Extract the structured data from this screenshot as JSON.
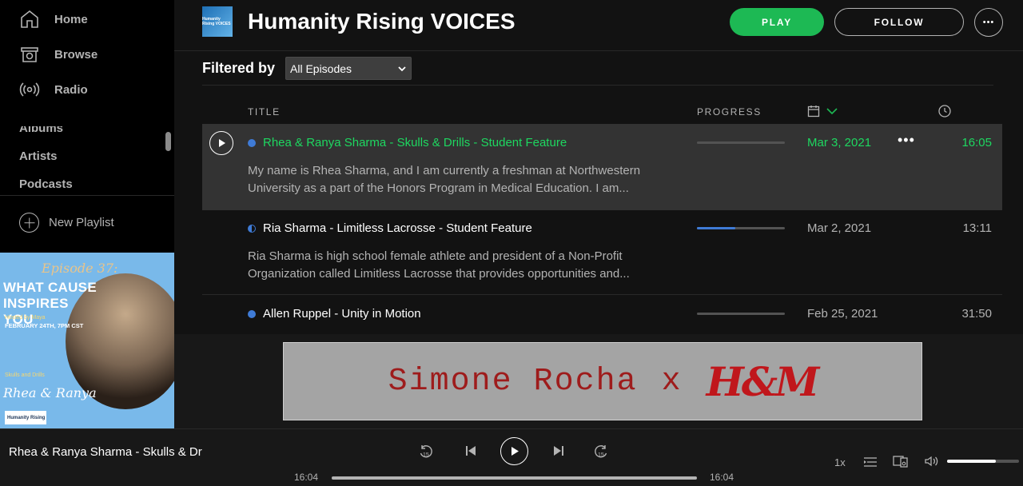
{
  "sidebar": {
    "nav": [
      {
        "label": "Home",
        "icon": "home-icon"
      },
      {
        "label": "Browse",
        "icon": "browse-icon"
      },
      {
        "label": "Radio",
        "icon": "radio-icon"
      }
    ],
    "library": [
      "Albums",
      "Artists",
      "Podcasts"
    ],
    "new_playlist": "New Playlist",
    "cover": {
      "episode": "Episode 37:",
      "headline": "WHAT CAUSE INSPIRES YOU",
      "hosted": "Hosted by Maya",
      "date": "FEBRUARY 24TH, 7PM CST",
      "topic": "Skulls and Drills",
      "names": "Rhea & Ranya",
      "logo": "Humanity Rising"
    }
  },
  "header": {
    "thumb_text": "Humanity Rising VOICES",
    "title": "Humanity Rising VOICES",
    "play_label": "PLAY",
    "follow_label": "FOLLOW",
    "more_label": "•••",
    "accent_color": "#1db954"
  },
  "filter": {
    "label": "Filtered by",
    "selected": "All Episodes"
  },
  "columns": {
    "title": "TITLE",
    "progress": "PROGRESS",
    "date_icon": "calendar-icon",
    "duration_icon": "clock-icon"
  },
  "episodes": [
    {
      "title": "Rhea & Ranya Sharma - Skulls & Drills - Student Feature",
      "desc1": "My name is Rhea Sharma, and I am currently a freshman at Northwestern",
      "desc2": "University as a part of the Honors Program in Medical Education. I am...",
      "progress": 0.0,
      "date": "Mar 3, 2021",
      "duration": "16:05",
      "more": "•••"
    },
    {
      "title": "Ria Sharma - Limitless Lacrosse - Student Feature",
      "desc1": "Ria Sharma is high school female athlete and president of a Non-Profit",
      "desc2": "Organization called Limitless Lacrosse that provides opportunities and...",
      "progress": 0.44,
      "date": "Mar 2, 2021",
      "duration": "13:11"
    },
    {
      "title": "Allen Ruppel - Unity in Motion",
      "progress": 0.0,
      "date": "Feb 25, 2021",
      "duration": "31:50"
    }
  ],
  "ad": {
    "brand": "Simone Rocha",
    "x": "x",
    "partner": "H&M"
  },
  "player": {
    "now_playing": "Rhea & Ranya Sharma - Skulls & Dr",
    "skip_back_label": "15",
    "skip_fwd_label": "15",
    "elapsed": "16:04",
    "total": "16:04",
    "position_fraction": 1.0,
    "speed": "1x",
    "volume_fraction": 0.68
  }
}
